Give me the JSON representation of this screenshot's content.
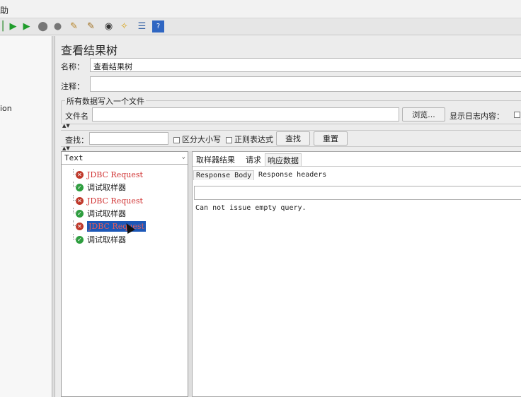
{
  "menu": {
    "help": "助"
  },
  "toolbar": {
    "icons": [
      "stop-icon",
      "start-icon",
      "start-no-pause-icon",
      "stop-all-icon",
      "shutdown-icon",
      "clear-icon",
      "clear-all-icon",
      "search-icon",
      "reset-search-icon",
      "function-helper-icon",
      "help-icon"
    ]
  },
  "left_panel": {
    "item_text": "ion"
  },
  "panel": {
    "title": "查看结果树",
    "name_label": "名称：",
    "name_value": "查看结果树",
    "comment_label": "注释：",
    "comment_value": "",
    "file_group_title": "所有数据写入一个文件",
    "filename_label": "文件名",
    "filename_value": "",
    "browse_label": "浏览...",
    "log_label": "显示日志内容："
  },
  "search": {
    "label": "查找：",
    "value": "",
    "case_label": "区分大小写",
    "regex_label": "正则表达式",
    "find_button": "查找",
    "reset_button": "重置"
  },
  "tree": {
    "renderer": "Text",
    "items": [
      {
        "label": "JDBC Request",
        "status": "error"
      },
      {
        "label": "调试取样器",
        "status": "success"
      },
      {
        "label": "JDBC Request",
        "status": "error"
      },
      {
        "label": "调试取样器",
        "status": "success"
      },
      {
        "label": "JDBC Request",
        "status": "error",
        "selected": true
      },
      {
        "label": "调试取样器",
        "status": "success"
      }
    ]
  },
  "result_tabs": {
    "tabs": [
      "取样器结果",
      "请求",
      "响应数据"
    ],
    "active": "响应数据",
    "subtabs": [
      "Response Body",
      "Response headers"
    ],
    "active_subtab": "Response Body",
    "response_search_value": "",
    "response_text": "Can not issue empty query."
  },
  "colors": {
    "error": "#d03232",
    "success": "#2e9e3f",
    "selection": "#1c58b8"
  }
}
